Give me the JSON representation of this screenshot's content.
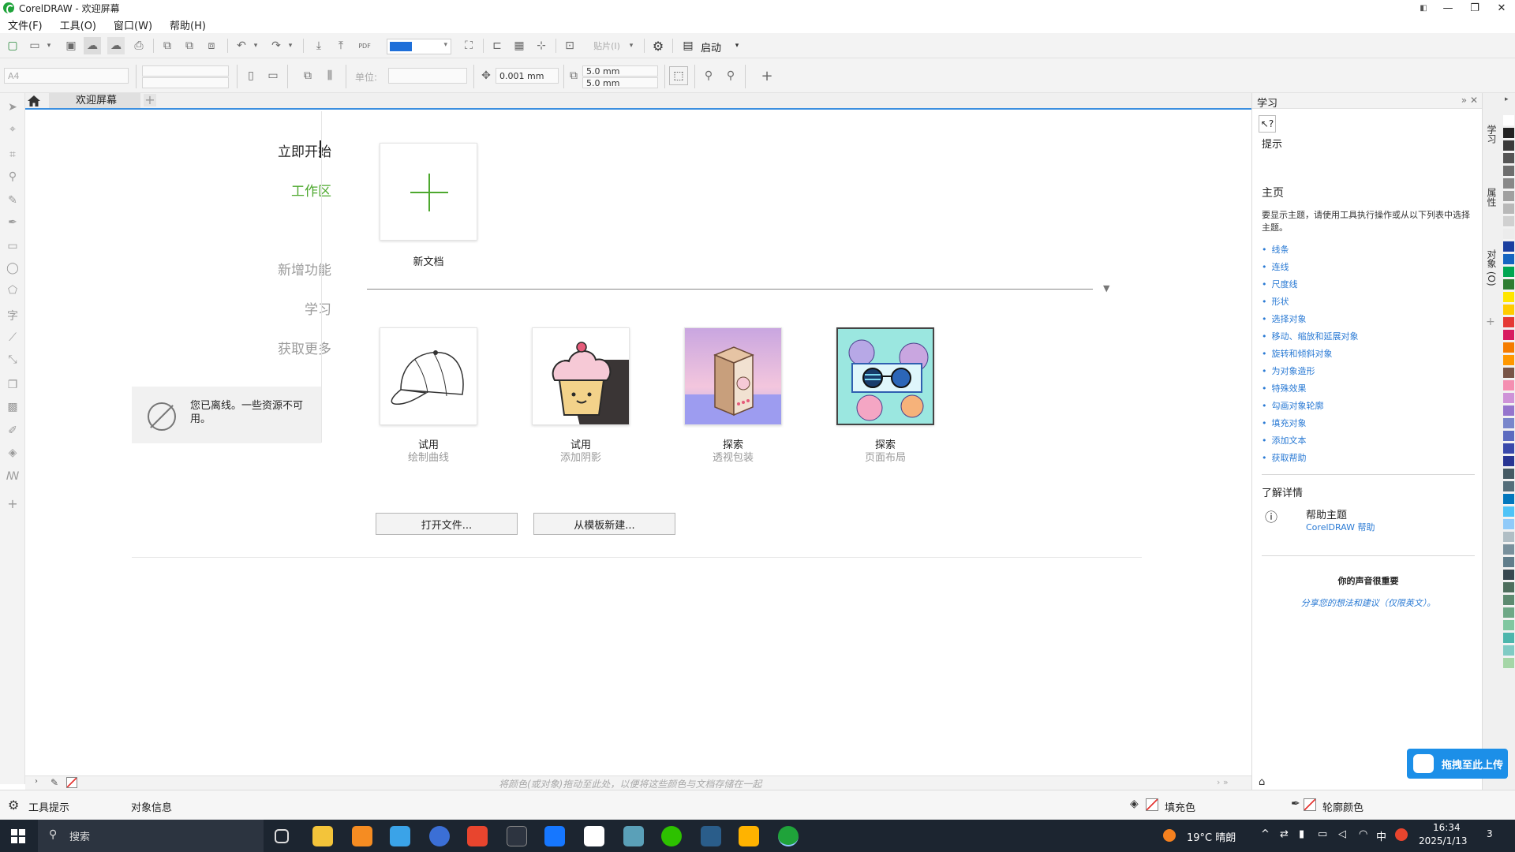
{
  "window": {
    "title": "CorelDRAW - 欢迎屏幕",
    "controls": {
      "restore_small": "◧",
      "minimize": "—",
      "restore": "❐",
      "close": "✕"
    }
  },
  "menu": [
    "文件(F)",
    "工具(O)",
    "窗口(W)",
    "帮助(H)"
  ],
  "toolbar": {
    "paste_label": "贴片(I)",
    "start_label": "启动",
    "page_size": "A4",
    "unit_label": "单位:",
    "nudge_value": "0.001 mm",
    "dup_x": "5.0 mm",
    "dup_y": "5.0 mm",
    "pdf_label": "PDF"
  },
  "tabs": {
    "welcome": "欢迎屏幕",
    "add": "+"
  },
  "welcome": {
    "nav": {
      "get_started": "立即开始",
      "workspace": "工作区",
      "whats_new": "新增功能",
      "learn": "学习",
      "get_more": "获取更多"
    },
    "offline_message": "您已离线。一些资源不可用。",
    "new_document": "新文档",
    "cards": [
      {
        "title": "试用",
        "subtitle": "绘制曲线"
      },
      {
        "title": "试用",
        "subtitle": "添加阴影"
      },
      {
        "title": "探索",
        "subtitle": "透视包装"
      },
      {
        "title": "探索",
        "subtitle": "页面布局"
      }
    ],
    "open_file_button": "打开文件...",
    "from_template_button": "从模板新建..."
  },
  "palette_hint": "将颜色(或对象)拖动至此处，以便将这些颜色与文档存储在一起",
  "status": {
    "tool_hints": "工具提示",
    "object_info": "对象信息",
    "fill_label": "填充色",
    "outline_label": "轮廓颜色"
  },
  "learn_panel": {
    "title": "学习",
    "hints_label": "提示",
    "home_heading": "主页",
    "home_desc": "要显示主题，请使用工具执行操作或从以下列表中选择主题。",
    "topics": [
      "线条",
      "连线",
      "尺度线",
      "形状",
      "选择对象",
      "移动、缩放和延展对象",
      "旋转和倾斜对象",
      "为对象造形",
      "特殊效果",
      "勾画对象轮廓",
      "填充对象",
      "添加文本",
      "获取帮助"
    ],
    "learn_more_heading": "了解详情",
    "help_topics": "帮助主题",
    "help_link": "CorelDRAW 帮助",
    "voice_heading": "你的声音很重要",
    "voice_link": "分享您的想法和建议（仅限英文）。",
    "side_tabs": [
      "学习",
      "属性",
      "对象 (O)"
    ]
  },
  "upload_button": "拖拽至此上传",
  "taskbar": {
    "search_placeholder": "搜索",
    "weather": "19°C 晴朗",
    "ime": "中",
    "time": "16:34",
    "date": "2025/1/13",
    "notifications": "3"
  },
  "palette_colors": [
    "#ffffff",
    "#222222",
    "#3a3a3a",
    "#555555",
    "#6e6e6e",
    "#888888",
    "#a0a0a0",
    "#b8b8b8",
    "#d0d0d0",
    "#ececec",
    "#1a3fa0",
    "#1565c0",
    "#00a651",
    "#2e7d32",
    "#ffe600",
    "#ffcc00",
    "#e53935",
    "#d81b60",
    "#f57c00",
    "#ff9800",
    "#795548",
    "#f48fb1",
    "#ce93d8",
    "#9575cd",
    "#7986cb",
    "#5c6bc0",
    "#3949ab",
    "#283593",
    "#455a64",
    "#546e7a",
    "#0277bd",
    "#4fc3f7",
    "#90caf9",
    "#b0bec5",
    "#78909c",
    "#607d8b",
    "#37474f",
    "#4e6e5d",
    "#5d8a70",
    "#6ea886",
    "#80c7a0",
    "#4db6ac",
    "#80cbc4",
    "#a5d6a7"
  ]
}
